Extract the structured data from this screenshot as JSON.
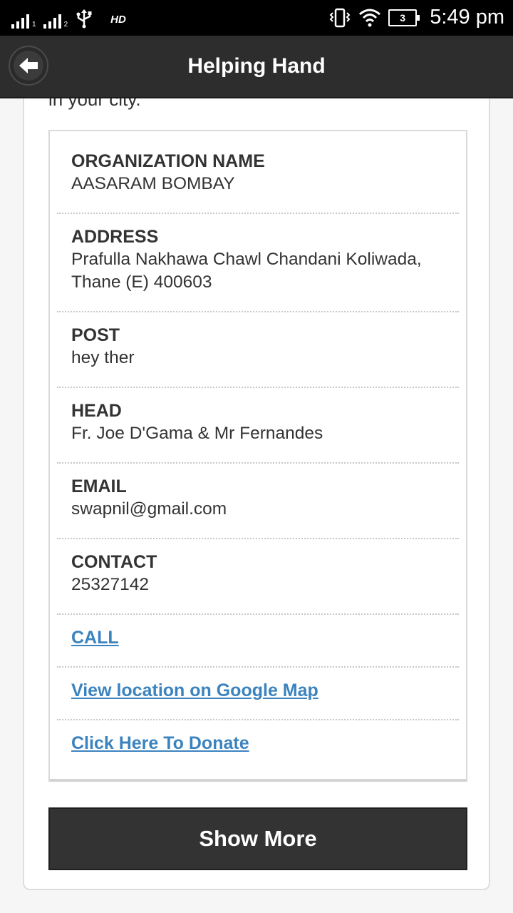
{
  "status_bar": {
    "hd_label": "HD",
    "battery_level": "3",
    "time": "5:49 pm"
  },
  "header": {
    "title": "Helping Hand"
  },
  "intro_partial_text": "in your city.",
  "fields": {
    "organization_name": {
      "label": "ORGANIZATION NAME",
      "value": "AASARAM BOMBAY"
    },
    "address": {
      "label": "ADDRESS",
      "value_line1": "Prafulla Nakhawa Chawl Chandani Koliwada,",
      "value_line2": "Thane (E) 400603"
    },
    "post": {
      "label": "POST",
      "value": "hey ther"
    },
    "head": {
      "label": "HEAD",
      "value": "Fr. Joe D'Gama & Mr Fernandes"
    },
    "email": {
      "label": "EMAIL",
      "value": "swapnil@gmail.com"
    },
    "contact": {
      "label": "CONTACT",
      "value": "25327142"
    }
  },
  "links": {
    "call": "CALL",
    "map": "View location on Google Map",
    "donate": "Click Here To Donate"
  },
  "show_more_label": "Show More",
  "colors": {
    "link": "#3b83bf",
    "header_bg": "#2d2d2d",
    "button_bg": "#333333"
  }
}
